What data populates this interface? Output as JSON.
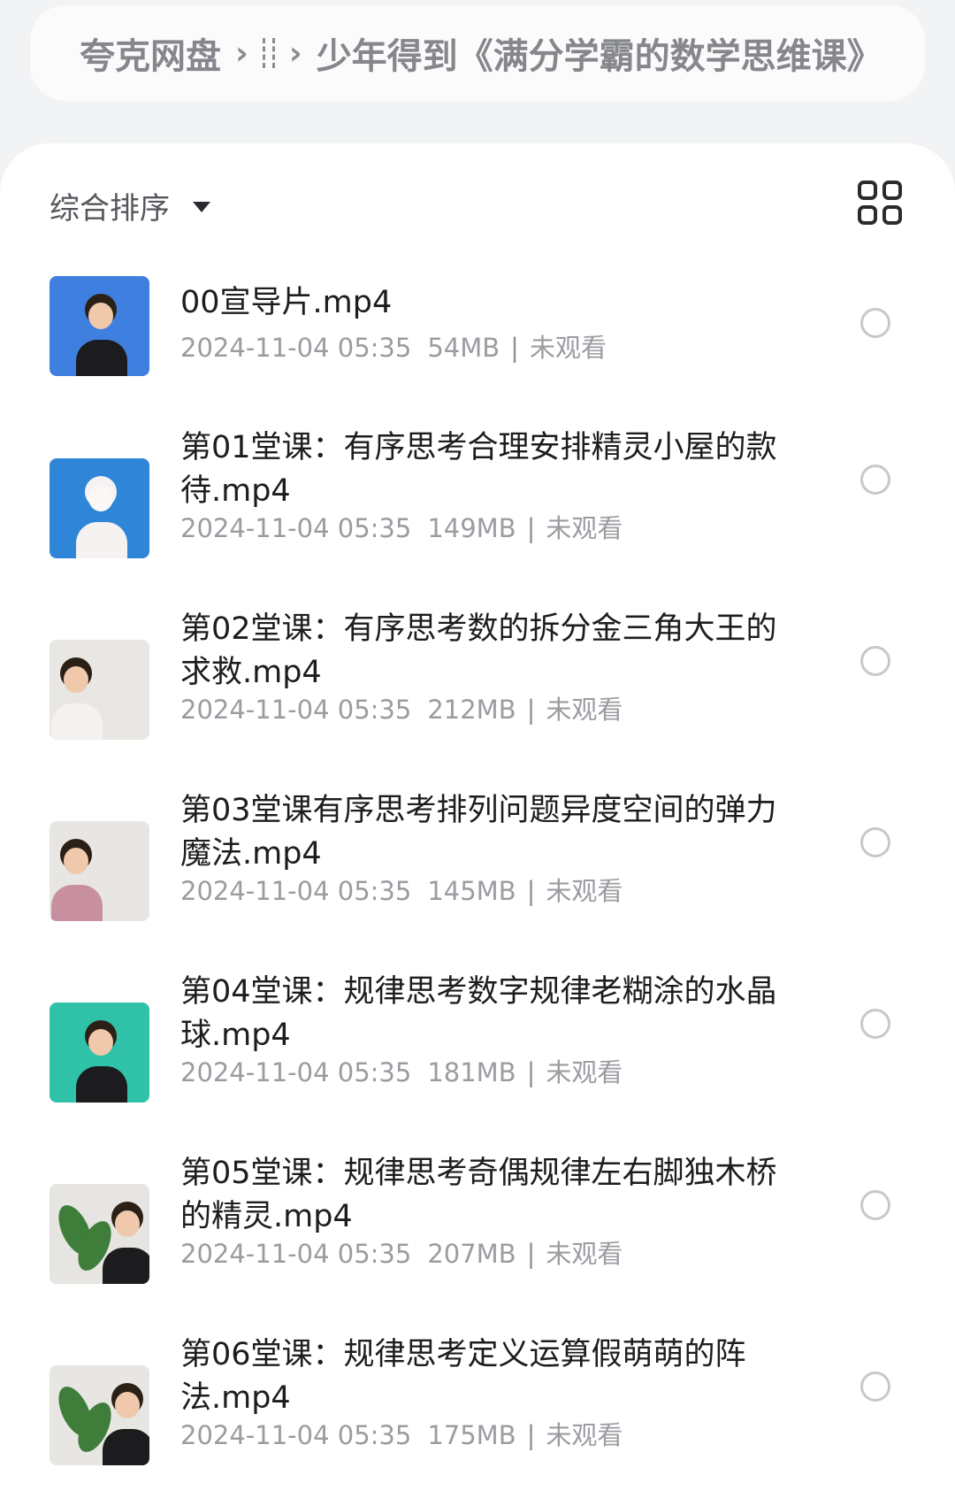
{
  "breadcrumb": {
    "root": "夸克网盘",
    "separator": "›",
    "current": "少年得到《满分学霸的数学思维课》"
  },
  "toolbar": {
    "sort_label": "综合排序",
    "sort_icon": "caret-down-icon",
    "view_icon": "grid-view-icon"
  },
  "files": [
    {
      "title": "00宣导片.mp4",
      "date": "2024-11-04 05:35",
      "size": "54MB",
      "sep": "|",
      "status": "未观看",
      "thumb_bg": "#3f7fe0"
    },
    {
      "title": "第01堂课：有序思考合理安排精灵小屋的款待.mp4",
      "date": "2024-11-04 05:35",
      "size": "149MB",
      "sep": "|",
      "status": "未观看",
      "thumb_bg": "#2f86d8"
    },
    {
      "title": "第02堂课：有序思考数的拆分金三角大王的求救.mp4",
      "date": "2024-11-04 05:35",
      "size": "212MB",
      "sep": "|",
      "status": "未观看",
      "thumb_bg": "#e9e7e3"
    },
    {
      "title": "第03堂课有序思考排列问题异度空间的弹力魔法.mp4",
      "date": "2024-11-04 05:35",
      "size": "145MB",
      "sep": "|",
      "status": "未观看",
      "thumb_bg": "#e8e6e2"
    },
    {
      "title": "第04堂课：规律思考数字规律老糊涂的水晶球.mp4",
      "date": "2024-11-04 05:35",
      "size": "181MB",
      "sep": "|",
      "status": "未观看",
      "thumb_bg": "#2fc2a8"
    },
    {
      "title": "第05堂课：规律思考奇偶规律左右脚独木桥的精灵.mp4",
      "date": "2024-11-04 05:35",
      "size": "207MB",
      "sep": "|",
      "status": "未观看",
      "thumb_bg": "#e6e5e1"
    },
    {
      "title": "第06堂课：规律思考定义运算假萌萌的阵法.mp4",
      "date": "2024-11-04 05:35",
      "size": "175MB",
      "sep": "|",
      "status": "未观看",
      "thumb_bg": "#e7e6e2"
    }
  ]
}
